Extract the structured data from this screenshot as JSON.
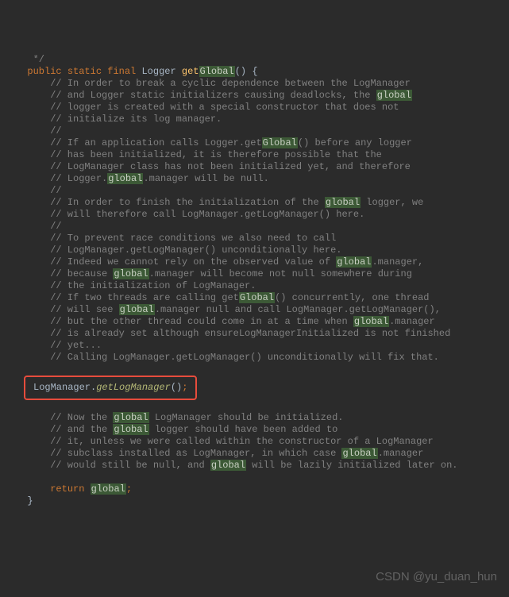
{
  "code": {
    "closing_comment": "   */",
    "signature": {
      "kw_public": "public",
      "kw_static": "static",
      "kw_final": "final",
      "type": "Logger",
      "method": "get",
      "method_hl": "Global",
      "parens": "()",
      "brace_open": " {"
    },
    "comments": [
      "      // In order to break a cyclic dependence between the LogManager",
      "      // and Logger static initializers causing deadlocks, the ",
      "      // logger is created with a special constructor that does not",
      "      // initialize its log manager.",
      "      //",
      "      // If an application calls Logger.get",
      "() before any logger",
      "      // has been initialized, it is therefore possible that the",
      "      // LogManager class has not been initialized yet, and therefore",
      "      // Logger.",
      ".manager will be null.",
      "      //",
      "      // In order to finish the initialization of the ",
      " logger, we",
      "      // will therefore call LogManager.getLogManager() here.",
      "      //",
      "      // To prevent race conditions we also need to call",
      "      // LogManager.getLogManager() unconditionally here.",
      "      // Indeed we cannot rely on the observed value of ",
      ".manager,",
      "      // because ",
      ".manager will become not null somewhere during",
      "      // the initialization of LogManager.",
      "      // If two threads are calling get",
      "() concurrently, one thread",
      "      // will see ",
      ".manager null and call LogManager.getLogManager(),",
      "      // but the other thread could come in at a time when ",
      ".manager",
      "      // is already set although ensureLogManagerInitialized is not finished",
      "      // yet...",
      "      // Calling LogManager.getLogManager() unconditionally will fix that."
    ],
    "hl_global": "global",
    "hl_Global": "Global",
    "boxed_line": {
      "obj": "LogManager.",
      "call": "getLogManager",
      "parens": "()",
      "semi": ";"
    },
    "comments2": [
      "      // Now the ",
      " LogManager should be initialized.",
      "      // and the ",
      " logger should have been added to",
      "      // it, unless we were called within the constructor of a LogManager",
      "      // subclass installed as LogManager, in which case ",
      ".manager",
      "      // would still be null, and ",
      " will be lazily initialized later on."
    ],
    "return_line": {
      "kw": "return",
      "val": "global",
      "semi": ";"
    },
    "brace_close": "  }"
  },
  "watermark": "CSDN @yu_duan_hun"
}
